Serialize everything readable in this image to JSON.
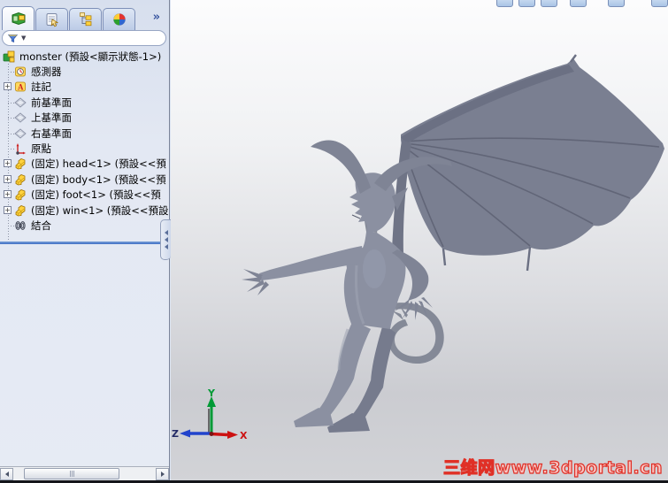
{
  "left_panel": {
    "tabs": [
      {
        "name": "featuremanager-tab",
        "icon": "featuremanager-icon",
        "active": true
      },
      {
        "name": "propertymanager-tab",
        "icon": "propertymanager-icon",
        "active": false
      },
      {
        "name": "configurationmanager-tab",
        "icon": "configurationmanager-icon",
        "active": false
      },
      {
        "name": "displaymanager-tab",
        "icon": "displaymanager-icon",
        "active": false
      }
    ],
    "overflow_chevron": "»",
    "filter": {
      "icon": "filter-funnel-icon",
      "caret": "▼"
    },
    "tree": {
      "items": [
        {
          "name": "tree-item-monster-root",
          "label": "monster (預設<顯示狀態-1>)",
          "icon": "assembly-icon",
          "root": true,
          "expander": false
        },
        {
          "name": "tree-item-sensors",
          "label": "感測器",
          "icon": "sensors-icon",
          "root": false,
          "expander": false
        },
        {
          "name": "tree-item-annotations",
          "label": "註記",
          "icon": "annotations-icon",
          "root": false,
          "expander": true
        },
        {
          "name": "tree-item-front-plane",
          "label": "前基準面",
          "icon": "plane-icon",
          "root": false,
          "expander": false
        },
        {
          "name": "tree-item-top-plane",
          "label": "上基準面",
          "icon": "plane-icon",
          "root": false,
          "expander": false
        },
        {
          "name": "tree-item-right-plane",
          "label": "右基準面",
          "icon": "plane-icon",
          "root": false,
          "expander": false
        },
        {
          "name": "tree-item-origin",
          "label": "原點",
          "icon": "origin-icon",
          "root": false,
          "expander": false
        },
        {
          "name": "tree-item-head",
          "label": "(固定) head<1> (預設<<預",
          "icon": "part-icon",
          "root": false,
          "expander": true
        },
        {
          "name": "tree-item-body",
          "label": "(固定) body<1> (預設<<預",
          "icon": "part-icon",
          "root": false,
          "expander": true
        },
        {
          "name": "tree-item-foot",
          "label": "(固定) foot<1> (預設<<預",
          "icon": "part-icon",
          "root": false,
          "expander": true
        },
        {
          "name": "tree-item-win",
          "label": "(固定) win<1> (預設<<預設",
          "icon": "part-icon",
          "root": false,
          "expander": true
        },
        {
          "name": "tree-item-mates",
          "label": "結合",
          "icon": "mates-icon",
          "root": false,
          "expander": false
        }
      ],
      "expander_glyph": "+"
    }
  },
  "viewport": {
    "model_subject": "winged demon monster assembly",
    "triad": {
      "x_label": "X",
      "y_label": "Y",
      "z_label": "Z",
      "x_color": "#cc1111",
      "y_color": "#009a36",
      "z_color": "#2244cc"
    },
    "watermark": "三维网www.3dportal.cn",
    "watermark_color": "#e03026",
    "model_color": "#8b90a1"
  },
  "colors": {
    "splitter_blue": "#3f6fc4",
    "panel_background": "#dce4f1",
    "viewport_top": "#fcfcfd",
    "viewport_bottom": "#cbccd1"
  }
}
